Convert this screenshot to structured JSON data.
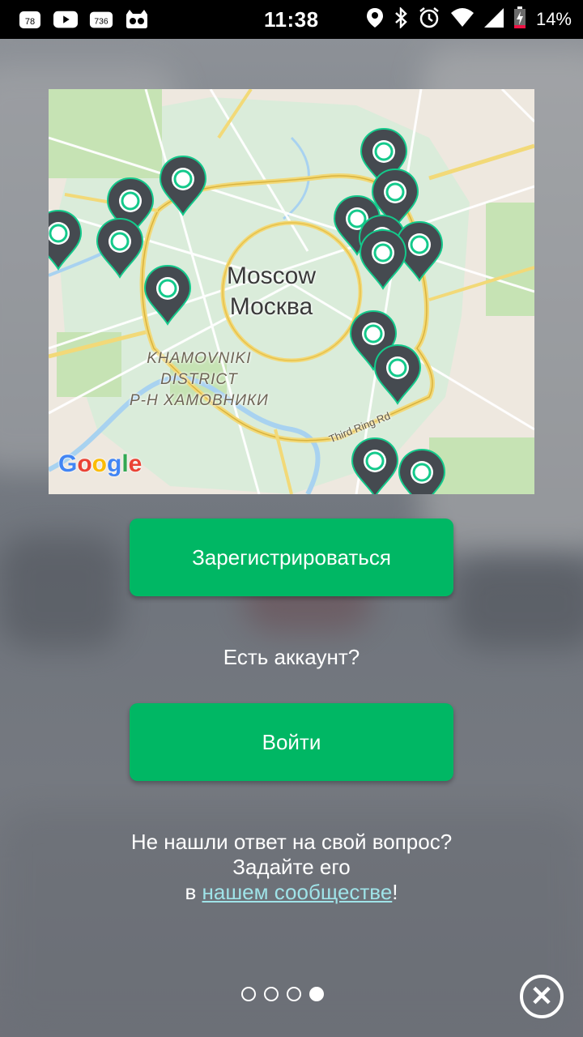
{
  "status_bar": {
    "time": "11:38",
    "battery": "14%",
    "notif_1": "78",
    "notif_2": "736",
    "icons": [
      "badge-78-icon",
      "youtube-icon",
      "badge-736-icon",
      "cat-icon",
      "location-icon",
      "bluetooth-icon",
      "alarm-icon",
      "wifi-icon",
      "signal-icon",
      "battery-icon"
    ]
  },
  "map": {
    "city_en": "Moscow",
    "city_ru": "Москва",
    "district": [
      "KHAMOVNIKI",
      "DISTRICT",
      "Р-Н ХАМОВНИКИ"
    ],
    "road_label": "Third Ring Rd",
    "provider_logo": "Google"
  },
  "buttons": {
    "register": "Зарегистрироваться",
    "login": "Войти"
  },
  "have_account": "Есть аккаунт?",
  "help": {
    "line1": "Не нашли ответ на свой вопрос?",
    "line2": "Задайте его",
    "line3_prefix": "в ",
    "link": "нашем сообществе",
    "line3_suffix": "!"
  },
  "pager": {
    "total": 4,
    "active_index": 3
  },
  "colors": {
    "accent": "#00b764",
    "pin": "#454a50",
    "pin_ring": "#14c98b",
    "link": "#9fe3e8"
  }
}
